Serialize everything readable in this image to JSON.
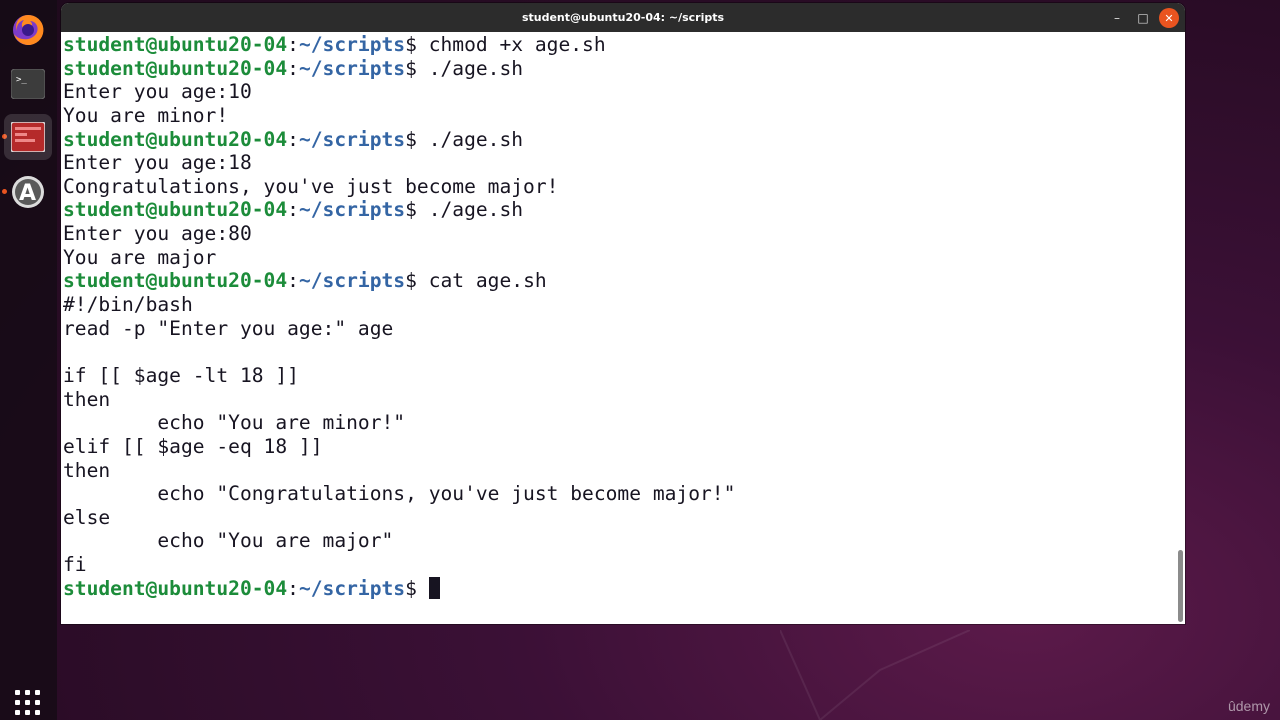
{
  "window": {
    "title": "student@ubuntu20-04: ~/scripts",
    "minimize_label": "–",
    "maximize_label": "□",
    "close_label": "✕"
  },
  "dock": {
    "items": [
      {
        "name": "firefox-icon"
      },
      {
        "name": "terminal-icon"
      },
      {
        "name": "red-app-icon"
      },
      {
        "name": "software-center-icon"
      }
    ],
    "show_apps": "show-applications-icon"
  },
  "terminal": {
    "prompt_user": "student@ubuntu20-04",
    "prompt_path": "~/scripts",
    "prompt_symbol": "$",
    "lines": [
      {
        "type": "prompt",
        "cmd": " chmod +x age.sh"
      },
      {
        "type": "prompt",
        "cmd": " ./age.sh"
      },
      {
        "type": "out",
        "text": "Enter you age:10"
      },
      {
        "type": "out",
        "text": "You are minor!"
      },
      {
        "type": "prompt",
        "cmd": " ./age.sh"
      },
      {
        "type": "out",
        "text": "Enter you age:18"
      },
      {
        "type": "out",
        "text": "Congratulations, you've just become major!"
      },
      {
        "type": "prompt",
        "cmd": " ./age.sh"
      },
      {
        "type": "out",
        "text": "Enter you age:80"
      },
      {
        "type": "out",
        "text": "You are major"
      },
      {
        "type": "prompt",
        "cmd": " cat age.sh"
      },
      {
        "type": "out",
        "text": "#!/bin/bash"
      },
      {
        "type": "out",
        "text": "read -p \"Enter you age:\" age"
      },
      {
        "type": "out",
        "text": ""
      },
      {
        "type": "out",
        "text": "if [[ $age -lt 18 ]]"
      },
      {
        "type": "out",
        "text": "then"
      },
      {
        "type": "out",
        "text": "        echo \"You are minor!\""
      },
      {
        "type": "out",
        "text": "elif [[ $age -eq 18 ]]"
      },
      {
        "type": "out",
        "text": "then"
      },
      {
        "type": "out",
        "text": "        echo \"Congratulations, you've just become major!\""
      },
      {
        "type": "out",
        "text": "else"
      },
      {
        "type": "out",
        "text": "        echo \"You are major\""
      },
      {
        "type": "out",
        "text": "fi"
      },
      {
        "type": "prompt",
        "cmd": " ",
        "cursor": true
      }
    ]
  },
  "watermark": "ûdemy",
  "colors": {
    "prompt_user": "#1c8c3a",
    "prompt_path": "#3465a4",
    "titlebar": "#2c2c2c",
    "close_button": "#e95420"
  }
}
